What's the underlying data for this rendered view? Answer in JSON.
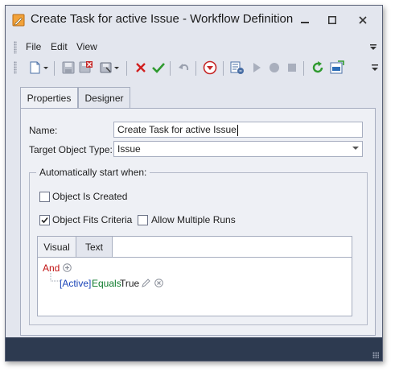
{
  "window": {
    "title": "Create Task for active Issue - Workflow Definition",
    "minimize": "minimize",
    "maximize": "maximize",
    "close": "close"
  },
  "menu": [
    "File",
    "Edit",
    "View"
  ],
  "toolbar": {
    "buttons": [
      "new-document",
      "save",
      "save-and-close",
      "save-options",
      "delete",
      "validate",
      "undo",
      "cancel-changes",
      "show-log",
      "run",
      "stop",
      "stop-all",
      "refresh",
      "export"
    ]
  },
  "tabs": {
    "properties": "Properties",
    "designer": "Designer"
  },
  "form": {
    "name_label": "Name:",
    "name_value": "Create Task for active Issue",
    "target_label": "Target Object Type:",
    "target_value": "Issue"
  },
  "group": {
    "title": "Automatically start when:",
    "object_created": {
      "label": "Object Is Created",
      "checked": false
    },
    "object_fits": {
      "label": "Object Fits Criteria",
      "checked": true
    },
    "allow_multiple": {
      "label": "Allow Multiple Runs",
      "checked": false
    }
  },
  "criteria_editor": {
    "tabs": [
      "Visual",
      "Text"
    ],
    "group_operator": "And",
    "condition": {
      "property": "[Active]",
      "operator": "Equals",
      "value": "True"
    }
  },
  "colors": {
    "and": "#c01010",
    "property": "#1a44b8",
    "operator": "#0c7a2a",
    "statusbar": "#2d3a50"
  }
}
